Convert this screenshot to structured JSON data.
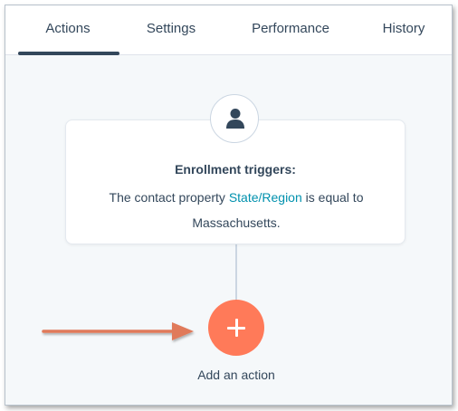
{
  "tabs": [
    {
      "label": "Actions",
      "active": true
    },
    {
      "label": "Settings",
      "active": false
    },
    {
      "label": "Performance",
      "active": false
    },
    {
      "label": "History",
      "active": false
    }
  ],
  "trigger": {
    "icon": "contact-person-icon",
    "title": "Enrollment triggers:",
    "text_before": "The contact property ",
    "property_link": "State/Region",
    "text_after": " is equal to",
    "value": "Massachusetts."
  },
  "add_action": {
    "icon": "plus-icon",
    "label": "Add an action"
  },
  "annotation": {
    "icon": "arrow-right-icon",
    "color": "#e07a5a"
  },
  "colors": {
    "accent": "#ff7a59",
    "link": "#0091ae",
    "text": "#33475b",
    "canvas": "#f5f8fa"
  }
}
